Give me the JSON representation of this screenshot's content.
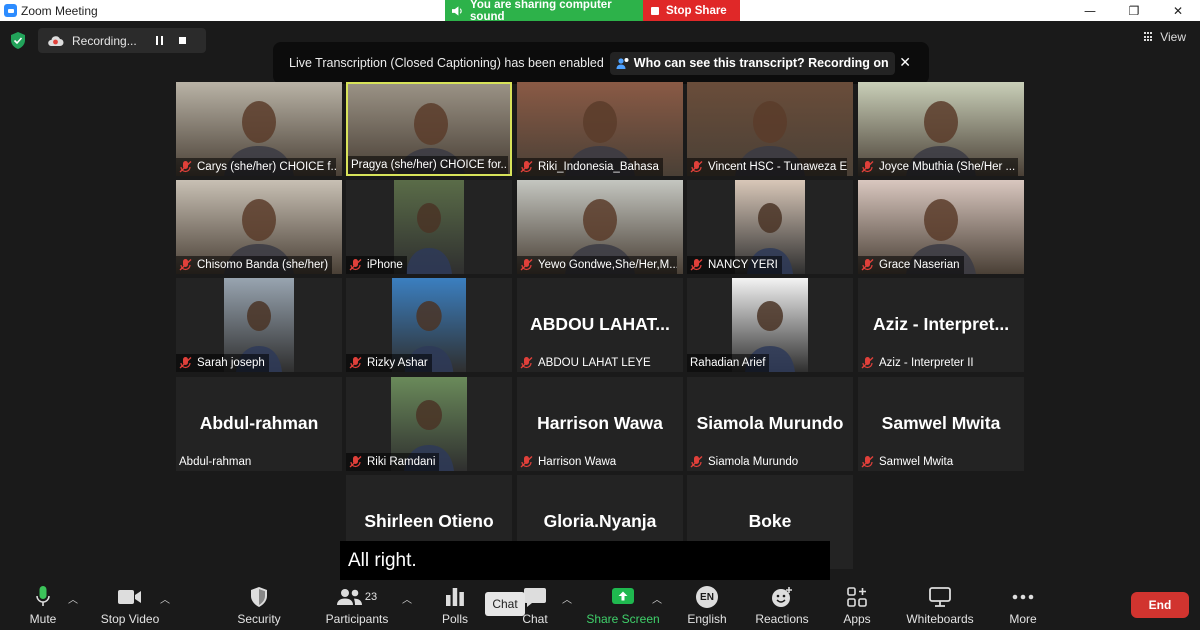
{
  "window": {
    "title": "Zoom Meeting",
    "controls": [
      "—",
      "❐",
      "✕"
    ]
  },
  "share_banner": {
    "sound_text": "You are sharing computer sound",
    "stop_label": "Stop Share"
  },
  "recording": {
    "label": "Recording..."
  },
  "view": {
    "label": "View"
  },
  "transcription": {
    "message": "Live Transcription (Closed Captioning) has been enabled",
    "link": "Who can see this transcript? Recording on",
    "close": "✕"
  },
  "participants": [
    {
      "name": "Carys (she/her) CHOICE f...",
      "muted": true,
      "video": "photo",
      "bg": "#b9b3a6"
    },
    {
      "name": "Pragya (she/her) CHOICE for...",
      "muted": false,
      "video": "photo",
      "bg": "#9a9285",
      "active": true
    },
    {
      "name": "Riki_Indonesia_Bahasa",
      "muted": true,
      "video": "photo",
      "bg": "#8a5a45"
    },
    {
      "name": "Vincent HSC - Tunaweza Em...",
      "muted": true,
      "video": "photo",
      "bg": "#6a4d3a"
    },
    {
      "name": "Joyce Mbuthia (She/Her ...",
      "muted": true,
      "video": "photo",
      "bg": "#c9cfb8"
    },
    {
      "name": "Chisomo Banda (she/her)",
      "muted": true,
      "video": "photo",
      "bg": "#c8c0b4"
    },
    {
      "name": "iPhone",
      "muted": true,
      "video": "small",
      "bg": "#5a6c48"
    },
    {
      "name": "Yewo Gondwe,She/Her,M...",
      "muted": true,
      "video": "photo",
      "bg": "#c4c6c0"
    },
    {
      "name": "NANCY YERI",
      "muted": true,
      "video": "small",
      "bg": "#d8c7b8"
    },
    {
      "name": "Grace Naserian",
      "muted": true,
      "video": "photo",
      "bg": "#d9c7bf"
    },
    {
      "name": "Sarah joseph",
      "muted": true,
      "video": "small",
      "bg": "#98a4b0"
    },
    {
      "name": "Rizky Ashar",
      "muted": true,
      "video": "small",
      "bg": "#3b7fc0"
    },
    {
      "name": "ABDOU LAHAT LEYE",
      "muted": true,
      "video": "text",
      "display": "ABDOU  LAHAT..."
    },
    {
      "name": "Rahadian Arief",
      "muted": false,
      "video": "small",
      "bg": "#f3f3f3"
    },
    {
      "name": "Aziz - Interpreter II",
      "muted": true,
      "video": "text",
      "display": "Aziz  -  Interpret..."
    },
    {
      "name": "Abdul-rahman",
      "muted": false,
      "video": "text",
      "display": "Abdul-rahman"
    },
    {
      "name": "Riki Ramdani",
      "muted": true,
      "video": "small",
      "bg": "#6a8a5a"
    },
    {
      "name": "Harrison Wawa",
      "muted": true,
      "video": "text",
      "display": "Harrison Wawa"
    },
    {
      "name": "Siamola Murundo",
      "muted": true,
      "video": "text",
      "display": "Siamola Murundo"
    },
    {
      "name": "Samwel Mwita",
      "muted": true,
      "video": "text",
      "display": "Samwel Mwita"
    },
    {
      "name": "Shirleen Otieno",
      "muted": true,
      "video": "text",
      "display": "Shirleen Otieno"
    },
    {
      "name": "Gloria.Nyanja",
      "muted": true,
      "video": "text",
      "display": "Gloria.Nyanja"
    },
    {
      "name": "Boke",
      "muted": true,
      "video": "text",
      "display": "Boke"
    }
  ],
  "caption": {
    "text": "All right."
  },
  "toolbar": {
    "mute": "Mute",
    "stop_video": "Stop Video",
    "security": "Security",
    "participants": "Participants",
    "participants_count": "23",
    "polls": "Polls",
    "chat": "Chat",
    "chat_tooltip": "Chat",
    "share_screen": "Share Screen",
    "english": "English",
    "english_badge": "EN",
    "reactions": "Reactions",
    "apps": "Apps",
    "whiteboards": "Whiteboards",
    "more": "More",
    "end": "End"
  },
  "colors": {
    "share_green": "#2db24a",
    "stop_red": "#e02828",
    "end_red": "#d1342f",
    "active_speaker": "#d8e35a",
    "muted_icon": "#e0403a"
  }
}
